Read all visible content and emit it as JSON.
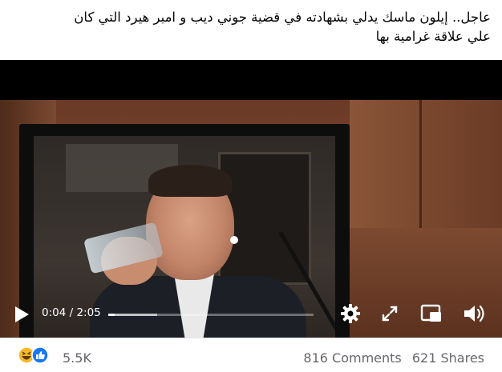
{
  "post": {
    "text_line1": "عاجل.. إيلون ماسك يدلي بشهادته  في قضية جوني ديب و امبر هيرد التي كان",
    "text_line2": "علي علاقة غرامية بها"
  },
  "video": {
    "current_time": "0:04",
    "duration": "2:05",
    "time_display": "0:04 / 2:05",
    "progress_fraction": 0.032,
    "buffered_fraction": 0.24
  },
  "controls": {
    "icons": [
      "play-icon",
      "gear-icon",
      "expand-icon",
      "picture-in-picture-icon",
      "volume-icon"
    ]
  },
  "reactions": {
    "icons": [
      "haha-icon",
      "like-icon"
    ],
    "count": "5.5K"
  },
  "stats": {
    "comments": "816 Comments",
    "shares": "621 Shares"
  },
  "colors": {
    "like_blue": "#1877f2",
    "haha_yellow": "#f7b928",
    "secondary_text": "#65676b"
  }
}
